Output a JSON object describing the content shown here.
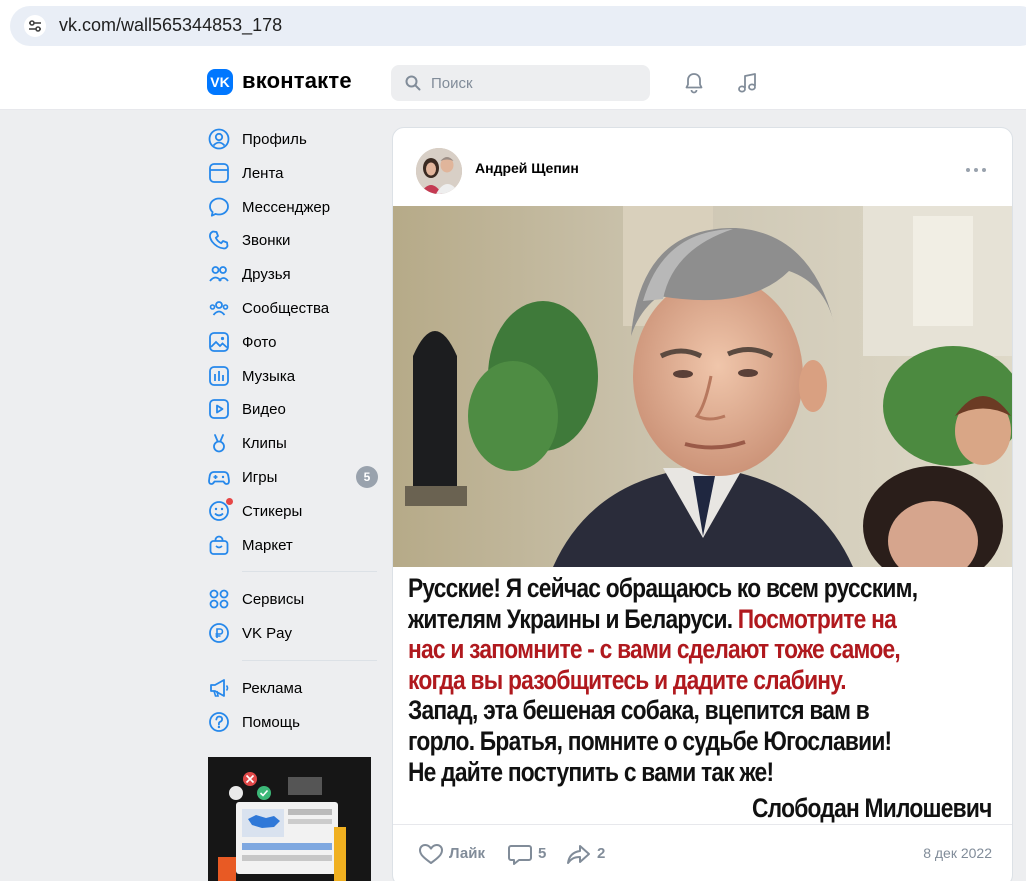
{
  "browser": {
    "url": "vk.com/wall565344853_178"
  },
  "header": {
    "logo_letters": "VK",
    "brand": "вконтакте",
    "search_placeholder": "Поиск"
  },
  "sidebar": {
    "items": [
      {
        "label": "Профиль",
        "icon": "profile-icon"
      },
      {
        "label": "Лента",
        "icon": "feed-icon"
      },
      {
        "label": "Мессенджер",
        "icon": "messenger-icon"
      },
      {
        "label": "Звонки",
        "icon": "phone-icon"
      },
      {
        "label": "Друзья",
        "icon": "friends-icon"
      },
      {
        "label": "Сообщества",
        "icon": "communities-icon"
      },
      {
        "label": "Фото",
        "icon": "photo-icon"
      },
      {
        "label": "Музыка",
        "icon": "music-icon"
      },
      {
        "label": "Видео",
        "icon": "video-icon"
      },
      {
        "label": "Клипы",
        "icon": "clips-icon"
      },
      {
        "label": "Игры",
        "icon": "games-icon",
        "badge": "5"
      },
      {
        "label": "Стикеры",
        "icon": "stickers-icon"
      },
      {
        "label": "Маркет",
        "icon": "market-icon"
      }
    ],
    "items2": [
      {
        "label": "Сервисы",
        "icon": "services-icon"
      },
      {
        "label": "VK Pay",
        "icon": "vkpay-icon"
      }
    ],
    "items3": [
      {
        "label": "Реклама",
        "icon": "ads-icon"
      },
      {
        "label": "Помощь",
        "icon": "help-icon"
      }
    ]
  },
  "post": {
    "author": "Андрей Щепин",
    "quote_lines": [
      {
        "parts": [
          {
            "text": "Русские! Я сейчас обращаюсь ко всем русским,",
            "color": "black"
          }
        ]
      },
      {
        "parts": [
          {
            "text": "жителям Украины и Беларуси. ",
            "color": "black"
          },
          {
            "text": "Посмотрите на",
            "color": "red"
          }
        ]
      },
      {
        "parts": [
          {
            "text": "нас и запомните - с вами сделают тоже самое,",
            "color": "red"
          }
        ]
      },
      {
        "parts": [
          {
            "text": "когда вы разобщитесь и дадите слабину.",
            "color": "red"
          }
        ]
      },
      {
        "parts": [
          {
            "text": "Запад, эта бешеная собака, вцепится вам в",
            "color": "black"
          }
        ]
      },
      {
        "parts": [
          {
            "text": "горло. Братья, помните о судьбе Югославии!",
            "color": "black"
          }
        ]
      },
      {
        "parts": [
          {
            "text": "Не дайте поступить с вами так же!",
            "color": "black"
          }
        ]
      }
    ],
    "signature": "Слободан Милошевич",
    "like_label": "Лайк",
    "comments_count": "5",
    "shares_count": "2",
    "date": "8 дек 2022"
  },
  "colors": {
    "accent": "#0077ff",
    "quote_red": "#b0191e",
    "muted": "#818c99",
    "background": "#edeef0"
  }
}
